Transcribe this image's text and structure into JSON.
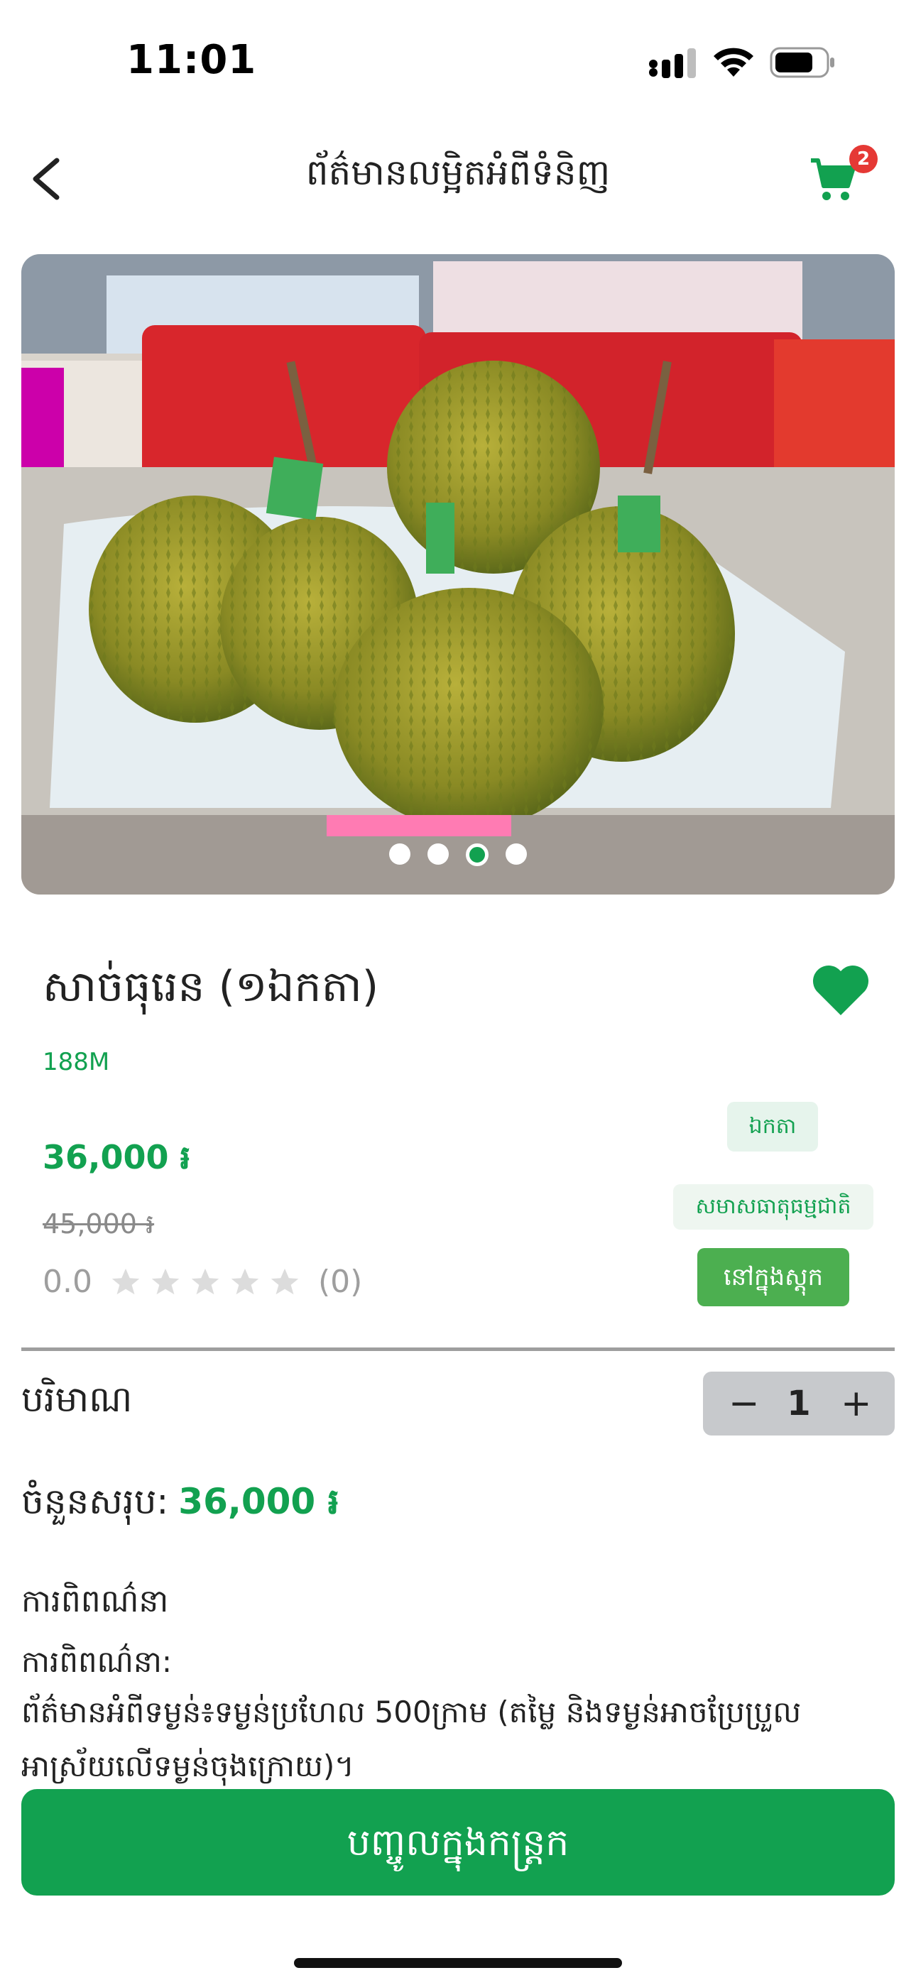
{
  "status_bar": {
    "time": "11:01"
  },
  "header": {
    "title": "ព័ត៌មានលម្អិតអំពីទំនិញ",
    "cart_count": "2"
  },
  "carousel": {
    "image_label": "durian product photo",
    "dot_count": 4,
    "active_index": 2
  },
  "product": {
    "name": "សាច់ធុរេន (១ឯកតា)",
    "brand": "188M",
    "price": "36,000 ៛",
    "old_price": "45,000 ៛",
    "rating_value": "0.0",
    "rating_stars": 0,
    "rating_count": "(0)",
    "favorited": true
  },
  "tags": {
    "unit": "ឯកតា",
    "supplier": "សមាសធាតុធម្មជាតិ",
    "stock": "នៅក្នុងស្តុក"
  },
  "quantity": {
    "label": "បរិមាណ",
    "minus": "−",
    "value": "1",
    "plus": "+"
  },
  "total": {
    "label": "ចំនួនសរុប:",
    "value": "36,000 ៛"
  },
  "description": {
    "heading": "ការពិពណ៌នា",
    "label": "ការពិពណ៌នា:",
    "body": "ព័ត៌មានអំពីទម្ងន់៖ទម្ងន់ប្រហែល 500ក្រាម (តម្លៃ និងទម្ងន់អាចប្រែប្រួលអាស្រ័យលើទម្ងន់ចុងក្រោយ)។"
  },
  "cta": {
    "label": "បញ្ចូលក្នុងកន្ត្រក"
  },
  "colors": {
    "brand_green": "#12a150",
    "badge_red": "#e53935",
    "stock_green": "#4caf50"
  }
}
